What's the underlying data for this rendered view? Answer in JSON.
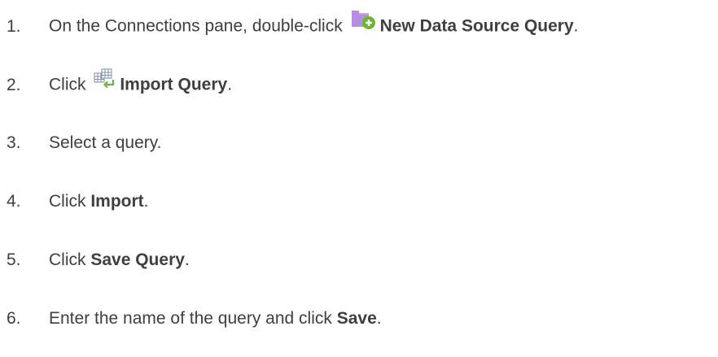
{
  "steps": [
    {
      "number": "1.",
      "text_before": "On the Connections pane, double-click",
      "icon": "new-data-source-query-icon",
      "bold": "New Data Source Query",
      "text_after": "."
    },
    {
      "number": "2.",
      "text_before": "Click",
      "icon": "import-query-icon",
      "bold": "Import Query",
      "text_after": "."
    },
    {
      "number": "3.",
      "text_before": "Select a query.",
      "bold": "",
      "text_after": ""
    },
    {
      "number": "4.",
      "text_before": "Click",
      "bold": "Import",
      "text_after": "."
    },
    {
      "number": "5.",
      "text_before": "Click",
      "bold": "Save Query",
      "text_after": "."
    },
    {
      "number": "6.",
      "text_before": "Enter the name of the query and click",
      "bold": "Save",
      "text_after": "."
    }
  ],
  "colors": {
    "text": "#3f3f3f",
    "folder": "#b78ee2",
    "plus_badge": "#6cb72e",
    "grid_icon": "#7c8fa8",
    "arrow": "#66b34a"
  }
}
